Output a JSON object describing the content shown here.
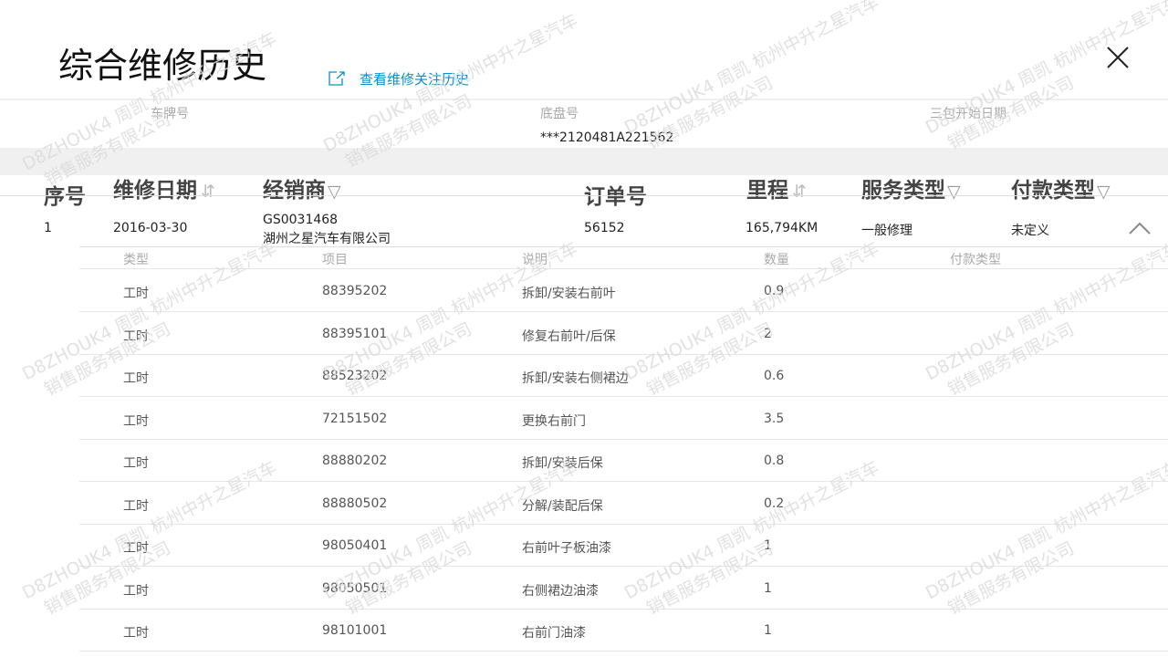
{
  "title": "综合维修历史",
  "view_link_label": "查看维修关注历史",
  "info": {
    "plate_label": "车牌号",
    "plate_value": "",
    "vin_label": "底盘号",
    "vin_value": "***2120481A221562",
    "warranty_label": "三包开始日期",
    "warranty_value": ""
  },
  "table": {
    "headers": {
      "seq": "序号",
      "date": "维修日期",
      "dealer": "经销商",
      "order": "订单号",
      "mileage": "里程",
      "service_type": "服务类型",
      "payment_type": "付款类型"
    },
    "rows": [
      {
        "seq": "1",
        "date": "2016-03-30",
        "dealer_code": "GS0031468",
        "dealer_name": "湖州之星汽车有限公司",
        "order": "56152",
        "mileage": "165,794KM",
        "service_type": "一般修理",
        "payment_type": "未定义"
      }
    ]
  },
  "details": {
    "headers": {
      "type": "类型",
      "item": "项目",
      "desc": "说明",
      "qty": "数量",
      "pay": "付款类型"
    },
    "rows": [
      {
        "type": "工时",
        "item": "88395202",
        "desc": "拆卸/安装右前叶",
        "qty": "0.9",
        "pay": ""
      },
      {
        "type": "工时",
        "item": "88395101",
        "desc": "修复右前叶/后保",
        "qty": "2",
        "pay": ""
      },
      {
        "type": "工时",
        "item": "88523202",
        "desc": "拆卸/安装右侧裙边",
        "qty": "0.6",
        "pay": ""
      },
      {
        "type": "工时",
        "item": "72151502",
        "desc": "更换右前门",
        "qty": "3.5",
        "pay": ""
      },
      {
        "type": "工时",
        "item": "88880202",
        "desc": "拆卸/安装后保",
        "qty": "0.8",
        "pay": ""
      },
      {
        "type": "工时",
        "item": "88880502",
        "desc": "分解/装配后保",
        "qty": "0.2",
        "pay": ""
      },
      {
        "type": "工时",
        "item": "98050401",
        "desc": "右前叶子板油漆",
        "qty": "1",
        "pay": ""
      },
      {
        "type": "工时",
        "item": "98050501",
        "desc": "右侧裙边油漆",
        "qty": "1",
        "pay": ""
      },
      {
        "type": "工时",
        "item": "98101001",
        "desc": "右前门油漆",
        "qty": "1",
        "pay": ""
      }
    ]
  },
  "watermark": {
    "line1": "D8ZHOUK4 周凯 杭州中升之星汽车",
    "line2": "销售服务有限公司"
  },
  "colors": {
    "link": "#0a8fd0",
    "band": "#f0f0f0",
    "muted": "#aaaaaa"
  },
  "icons": [
    "external-link-icon",
    "close-icon",
    "sort-icon",
    "filter-icon",
    "chevron-up-icon"
  ]
}
